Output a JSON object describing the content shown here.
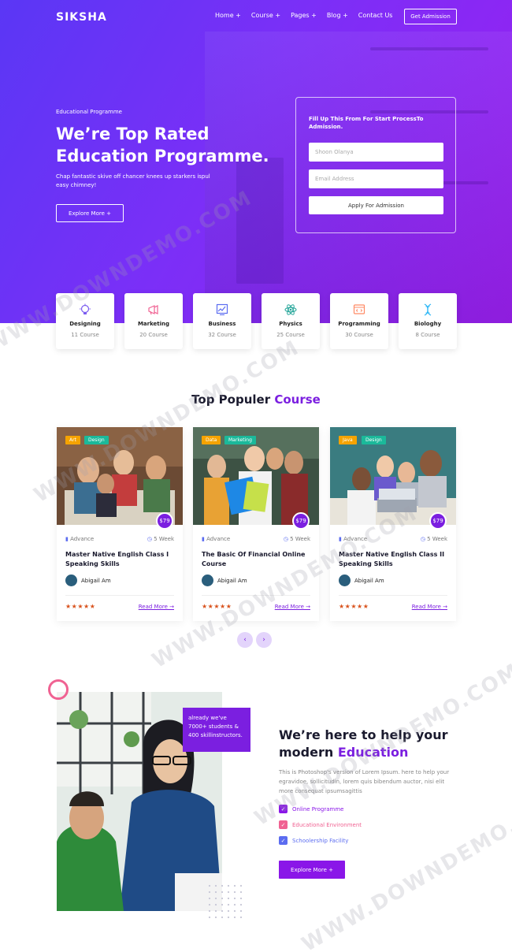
{
  "header": {
    "logo": "SIKSHA",
    "nav": [
      "Home +",
      "Course +",
      "Pages +",
      "Blog +",
      "Contact Us"
    ],
    "cta": "Get Admission"
  },
  "hero": {
    "eyebrow": "Educational Programme",
    "title": "We’re Top Rated Education Programme.",
    "subtitle": "Chap fantastic skive off chancer knees up starkers ispul easy chimney!",
    "button": "Explore More +"
  },
  "form": {
    "title": "Fill Up This From For Start ProcessTo Admission.",
    "name_placeholder": "Shoon Olanya",
    "email_placeholder": "Email Address",
    "submit": "Apply For Admission"
  },
  "categories": [
    {
      "name": "Designing",
      "count": "11 Course",
      "icon": "bulb-icon",
      "color": "#7b5cf0"
    },
    {
      "name": "Marketing",
      "count": "20 Course",
      "icon": "megaphone-icon",
      "color": "#f06292"
    },
    {
      "name": "Business",
      "count": "32 Course",
      "icon": "chart-icon",
      "color": "#5b6cf0"
    },
    {
      "name": "Physics",
      "count": "25 Course",
      "icon": "atom-icon",
      "color": "#26a69a"
    },
    {
      "name": "Programming",
      "count": "30 Course",
      "icon": "code-icon",
      "color": "#ff8a65"
    },
    {
      "name": "Biologhy",
      "count": "8 Course",
      "icon": "dna-icon",
      "color": "#29b6f6"
    }
  ],
  "courses_section": {
    "title_main": "Top Populer ",
    "title_accent": "Course"
  },
  "courses": [
    {
      "tags": [
        "Art",
        "Design"
      ],
      "price": "$79",
      "level": "Advance",
      "duration": "5 Week",
      "title": "Master Native English Class I Speaking Skills",
      "author": "Abigail Am",
      "stars": "★★★★★",
      "read_more": "Read More →"
    },
    {
      "tags": [
        "Data",
        "Marketing"
      ],
      "price": "$79",
      "level": "Advance",
      "duration": "5 Week",
      "title": "The Basic Of Financial Online Course",
      "author": "Abigail Am",
      "stars": "★★★★★",
      "read_more": "Read More →"
    },
    {
      "tags": [
        "Java",
        "Design"
      ],
      "price": "$79",
      "level": "Advance",
      "duration": "5 Week",
      "title": "Master Native English Class II Speaking Skills",
      "author": "Abigail Am",
      "stars": "★★★★★",
      "read_more": "Read More →"
    }
  ],
  "pager": {
    "prev": "‹",
    "next": "›"
  },
  "about": {
    "stat": "already we've 7000+ students & 400 skillinstructors.",
    "title_main": "We’re here to help your modern ",
    "title_accent": "Education",
    "para": "This is Photoshop's version of Lorem Ipsum. here to help your egravidoe, sollicitudin, lorem quis bibendum auctor, nisi elit more consequat ipsumsagittis",
    "features": [
      {
        "label": "Online Programme",
        "color": "#8a16e8"
      },
      {
        "label": "Educational Environment",
        "color": "#f06292"
      },
      {
        "label": "Schoolership Facility",
        "color": "#5b6cf0"
      }
    ],
    "button": "Explore More +"
  },
  "watermarks": [
    "WWW.DOWNDEMO.COM"
  ]
}
